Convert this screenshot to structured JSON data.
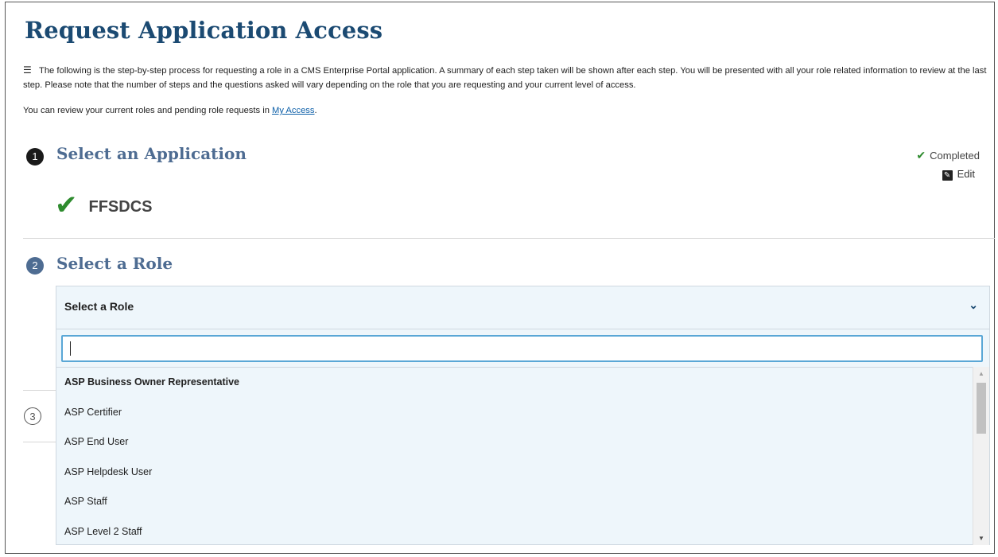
{
  "page": {
    "title": "Request Application Access",
    "intro_icon": "list-icon",
    "intro_text": "The following is the step-by-step process for requesting a role in a CMS Enterprise Portal application. A summary of each step taken will be shown after each step. You will be presented with all your role related information to review at the last step. Please note that the number of steps and the questions asked will vary depending on the role that you are requesting and your current level of access.",
    "review_text": "You can review your current roles and pending role requests in ",
    "review_link": "My Access",
    "review_end": "."
  },
  "steps": [
    {
      "number": "1",
      "title": "Select an Application",
      "status": "Completed",
      "edit_label": "Edit",
      "selected_value": "FFSDCS"
    },
    {
      "number": "2",
      "title": "Select a Role"
    },
    {
      "number": "3"
    }
  ],
  "dropdown": {
    "label": "Select a Role",
    "search_value": "",
    "options": [
      "ASP Business Owner Representative",
      "ASP Certifier",
      "ASP End User",
      "ASP Helpdesk User",
      "ASP Staff",
      "ASP Level 2 Staff"
    ],
    "highlighted_index": 0,
    "scroll_fraction": 0.0
  },
  "colors": {
    "title": "#1b4a72",
    "step_title": "#4e6c92",
    "check": "#2e8b2e",
    "link": "#0b5ea8",
    "dropdown_bg": "#eef6fb",
    "focus_border": "#5aa7d6"
  }
}
